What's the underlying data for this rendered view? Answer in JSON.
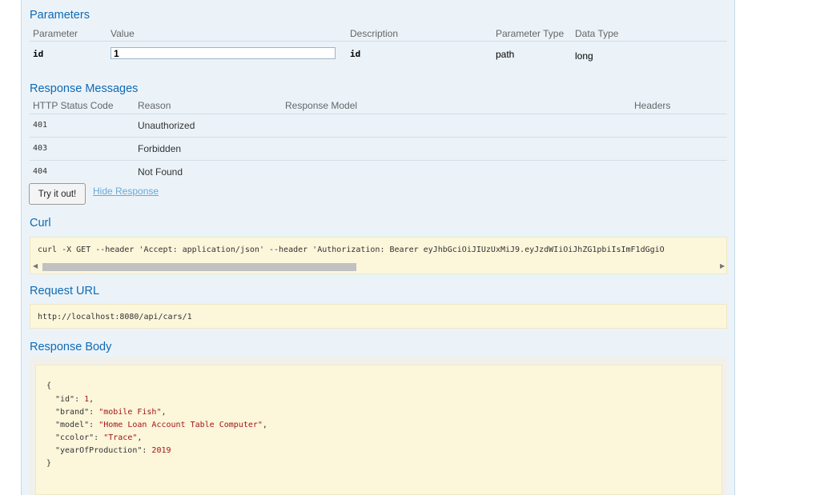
{
  "parameters": {
    "title": "Parameters",
    "headers": [
      "Parameter",
      "Value",
      "Description",
      "Parameter Type",
      "Data Type"
    ],
    "row": {
      "name": "id",
      "value": "1",
      "description": "id",
      "param_type": "path",
      "data_type": "long"
    }
  },
  "responses": {
    "title": "Response Messages",
    "headers": [
      "HTTP Status Code",
      "Reason",
      "Response Model",
      "Headers"
    ],
    "rows": [
      {
        "code": "401",
        "reason": "Unauthorized"
      },
      {
        "code": "403",
        "reason": "Forbidden"
      },
      {
        "code": "404",
        "reason": "Not Found"
      }
    ]
  },
  "actions": {
    "try_label": "Try it out!",
    "hide_label": "Hide Response"
  },
  "curl": {
    "title": "Curl",
    "command": "curl -X GET --header 'Accept: application/json' --header 'Authorization: Bearer eyJhbGciOiJIUzUxMiJ9.eyJzdWIiOiJhZG1pbiIsImF1dGgiO"
  },
  "request_url": {
    "title": "Request URL",
    "value": "http://localhost:8080/api/cars/1"
  },
  "response_body": {
    "title": "Response Body",
    "open": "{",
    "close": "}",
    "fields": [
      {
        "key": "\"id\"",
        "value": "1",
        "trail": ","
      },
      {
        "key": "\"brand\"",
        "value": "\"mobile Fish\"",
        "trail": ","
      },
      {
        "key": "\"model\"",
        "value": "\"Home Loan Account Table Computer\"",
        "trail": ","
      },
      {
        "key": "\"ccolor\"",
        "value": "\"Trace\"",
        "trail": ","
      },
      {
        "key": "\"yearOfProduction\"",
        "value": "2019",
        "trail": ""
      }
    ]
  },
  "colors": {
    "accent": "#0f6ab4",
    "panel": "#ebf3f9",
    "code_bg": "#fcf6db"
  },
  "icons": {
    "scroll_left": "left-arrow-icon",
    "scroll_right": "right-arrow-icon"
  }
}
